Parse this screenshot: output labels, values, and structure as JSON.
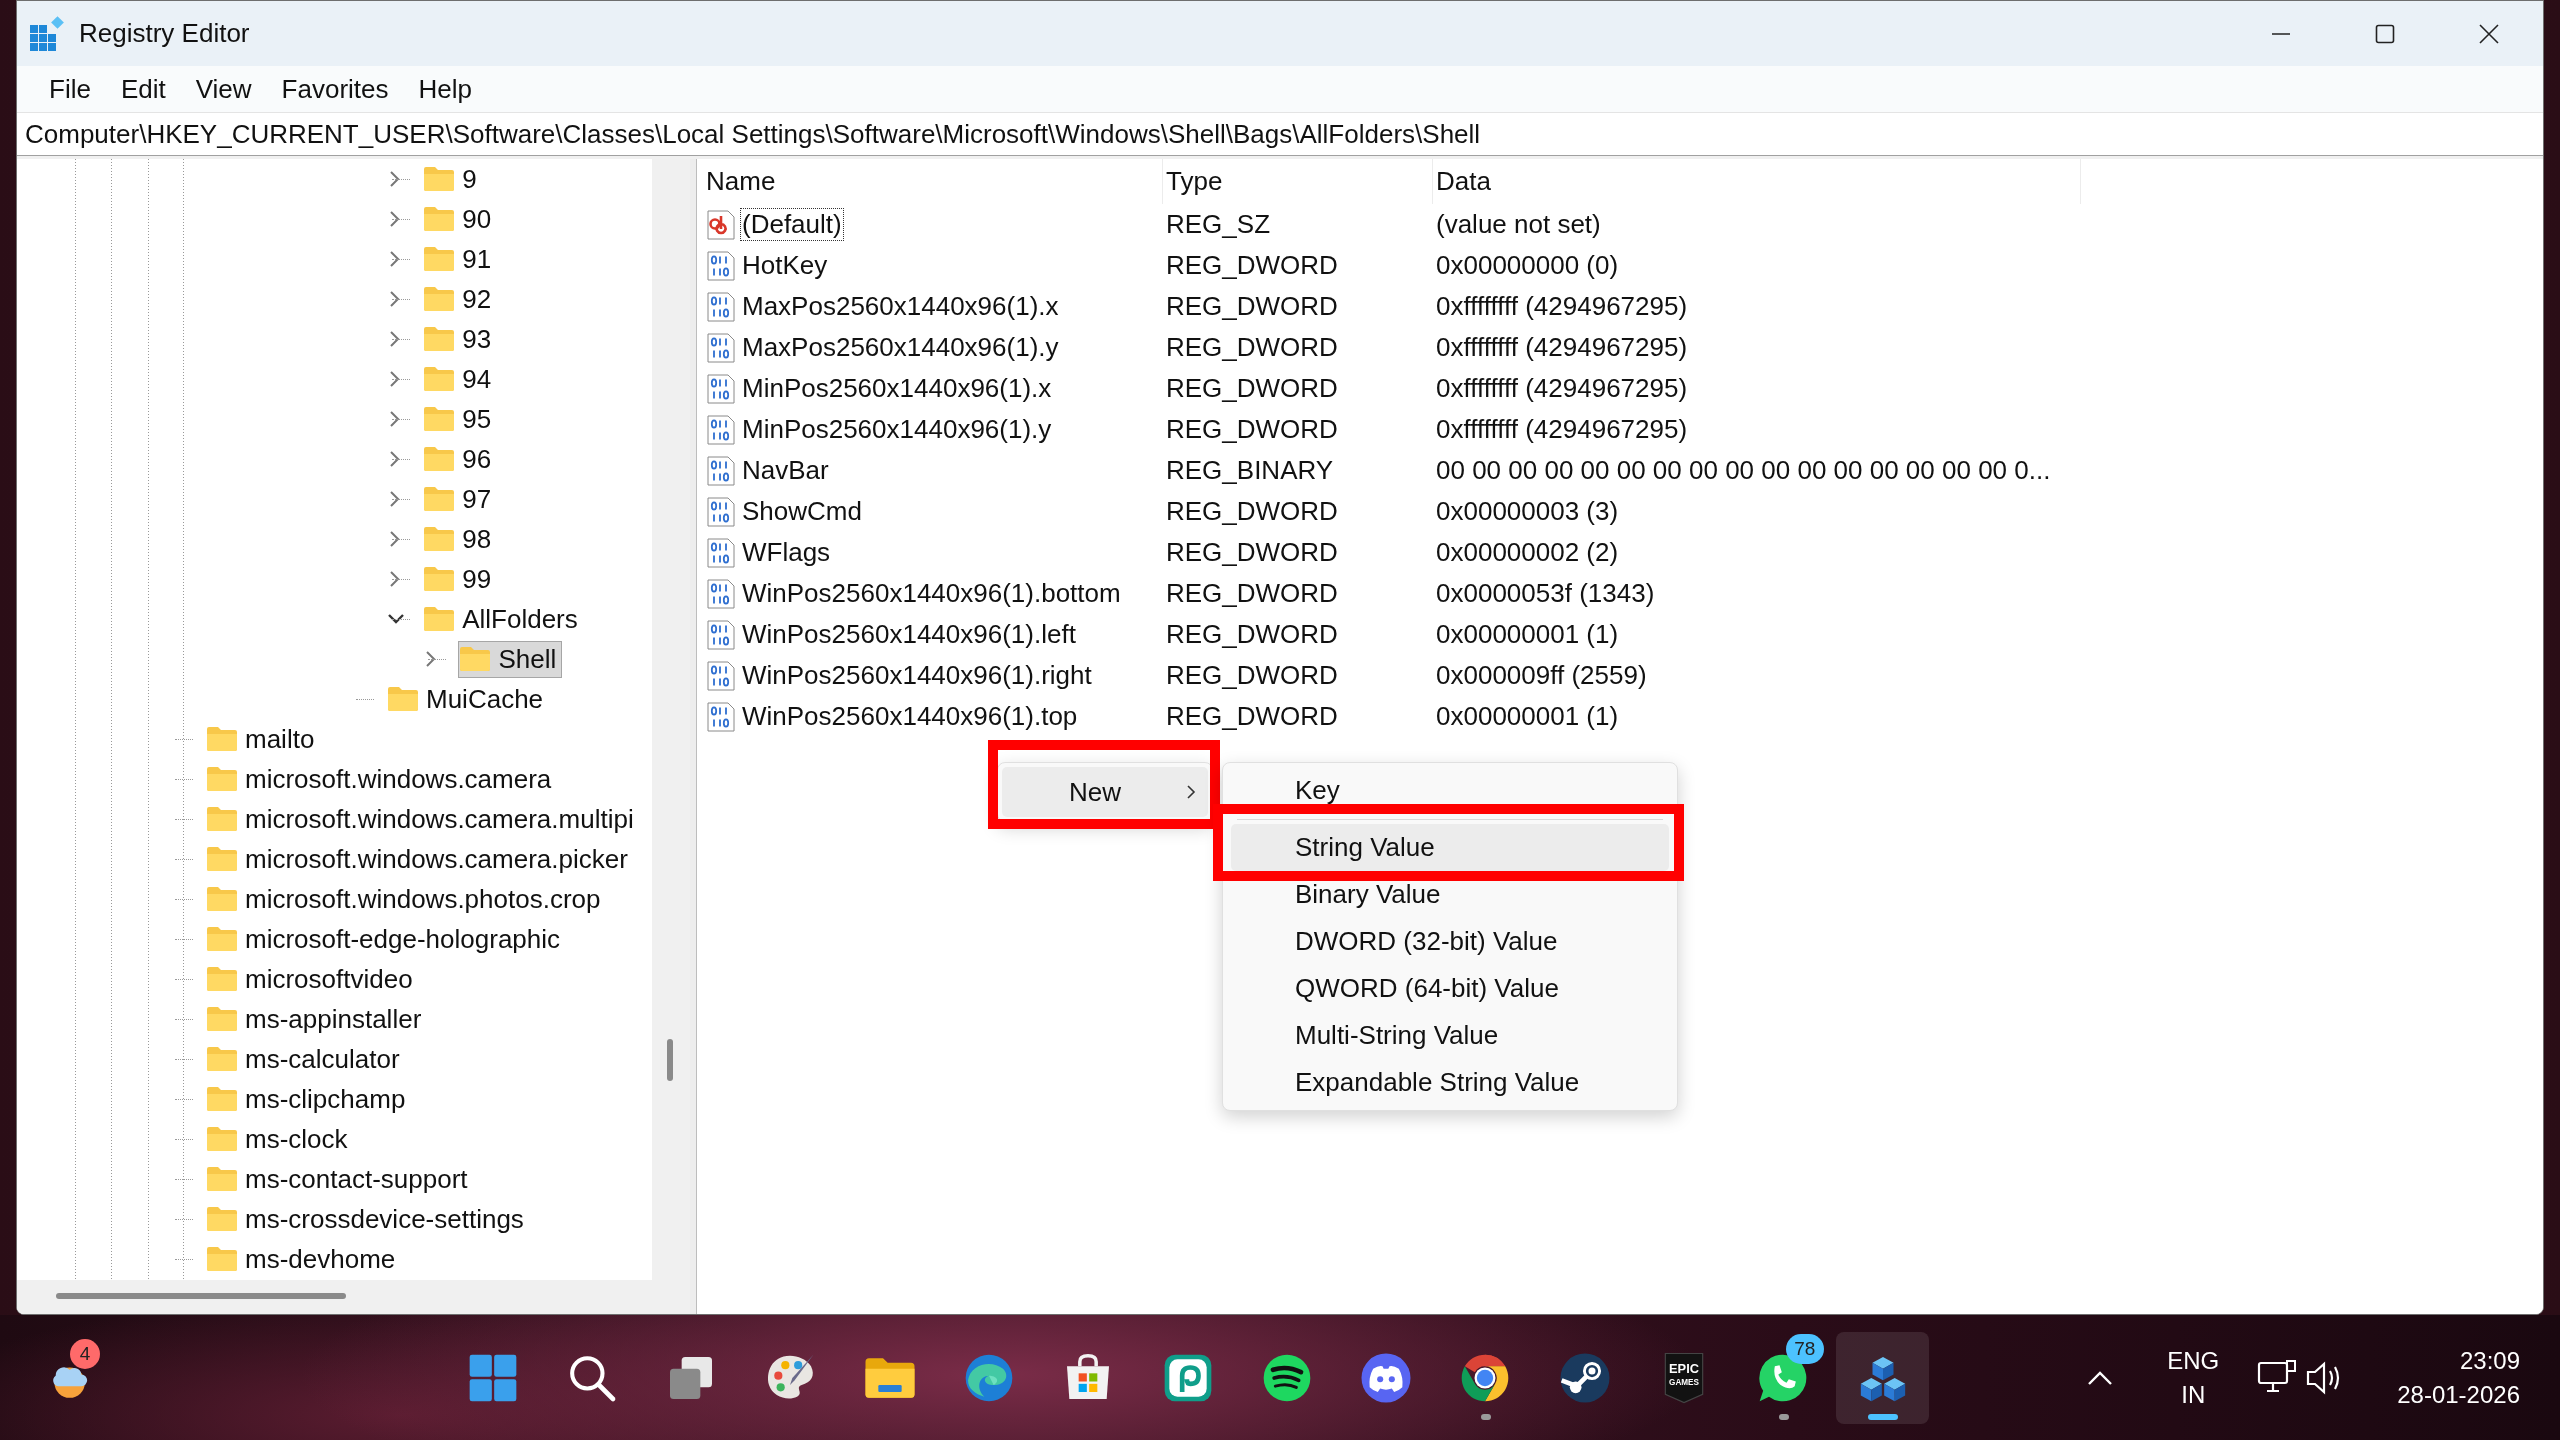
{
  "window": {
    "title": "Registry Editor"
  },
  "menu_bar": [
    "File",
    "Edit",
    "View",
    "Favorites",
    "Help"
  ],
  "address": "Computer\\HKEY_CURRENT_USER\\Software\\Classes\\Local Settings\\Software\\Microsoft\\Windows\\Shell\\Bags\\AllFolders\\Shell",
  "tree": {
    "items": [
      {
        "children": [
          {
            "children": [
              {
                "children": [
                  {
                    "children": [
                      {
                        "children": [
                          {
                            "children": [
                              {
                                "label": "9",
                                "expanded": false,
                                "selected": false
                              },
                              {
                                "label": "90",
                                "expanded": false,
                                "selected": false
                              },
                              {
                                "label": "91",
                                "expanded": false,
                                "selected": false
                              },
                              {
                                "label": "92",
                                "expanded": false,
                                "selected": false
                              },
                              {
                                "label": "93",
                                "expanded": false,
                                "selected": false
                              },
                              {
                                "label": "94",
                                "expanded": false,
                                "selected": false
                              },
                              {
                                "label": "95",
                                "expanded": false,
                                "selected": false
                              },
                              {
                                "label": "96",
                                "expanded": false,
                                "selected": false
                              },
                              {
                                "label": "97",
                                "expanded": false,
                                "selected": false
                              },
                              {
                                "label": "98",
                                "expanded": false,
                                "selected": false
                              },
                              {
                                "label": "99",
                                "expanded": false,
                                "selected": false
                              },
                              {
                                "label": "AllFolders",
                                "expanded": true,
                                "selected": false,
                                "children": [
                                  {
                                    "label": "Shell",
                                    "expanded": false,
                                    "selected": true
                                  }
                                ]
                              }
                            ]
                          },
                          {
                            "label": "MuiCache",
                            "selected": false
                          }
                        ]
                      }
                    ]
                  }
                ]
              }
            ]
          }
        ]
      },
      {
        "label": "mailto",
        "selected": false
      },
      {
        "label": "microsoft.windows.camera",
        "selected": false
      },
      {
        "label": "microsoft.windows.camera.multipi",
        "selected": false
      },
      {
        "label": "microsoft.windows.camera.picker",
        "selected": false
      },
      {
        "label": "microsoft.windows.photos.crop",
        "selected": false
      },
      {
        "label": "microsoft-edge-holographic",
        "selected": false
      },
      {
        "label": "microsoftvideo",
        "selected": false
      },
      {
        "label": "ms-appinstaller",
        "selected": false
      },
      {
        "label": "ms-calculator",
        "selected": false
      },
      {
        "label": "ms-clipchamp",
        "selected": false
      },
      {
        "label": "ms-clock",
        "selected": false
      },
      {
        "label": "ms-contact-support",
        "selected": false
      },
      {
        "label": "ms-crossdevice-settings",
        "selected": false
      },
      {
        "label": "ms-devhome",
        "selected": false
      }
    ]
  },
  "values": {
    "columns": [
      "Name",
      "Type",
      "Data"
    ],
    "rows": [
      {
        "kind": "string",
        "name": "(Default)",
        "type": "REG_SZ",
        "data": "(value not set)",
        "focused": true
      },
      {
        "kind": "binary",
        "name": "HotKey",
        "type": "REG_DWORD",
        "data": "0x00000000 (0)",
        "focused": false
      },
      {
        "kind": "binary",
        "name": "MaxPos2560x1440x96(1).x",
        "type": "REG_DWORD",
        "data": "0xffffffff (4294967295)",
        "focused": false
      },
      {
        "kind": "binary",
        "name": "MaxPos2560x1440x96(1).y",
        "type": "REG_DWORD",
        "data": "0xffffffff (4294967295)",
        "focused": false
      },
      {
        "kind": "binary",
        "name": "MinPos2560x1440x96(1).x",
        "type": "REG_DWORD",
        "data": "0xffffffff (4294967295)",
        "focused": false
      },
      {
        "kind": "binary",
        "name": "MinPos2560x1440x96(1).y",
        "type": "REG_DWORD",
        "data": "0xffffffff (4294967295)",
        "focused": false
      },
      {
        "kind": "binary",
        "name": "NavBar",
        "type": "REG_BINARY",
        "data": "00 00 00 00 00 00 00 00 00 00 00 00 00 00 00 00 0...",
        "focused": false
      },
      {
        "kind": "binary",
        "name": "ShowCmd",
        "type": "REG_DWORD",
        "data": "0x00000003 (3)",
        "focused": false
      },
      {
        "kind": "binary",
        "name": "WFlags",
        "type": "REG_DWORD",
        "data": "0x00000002 (2)",
        "focused": false
      },
      {
        "kind": "binary",
        "name": "WinPos2560x1440x96(1).bottom",
        "type": "REG_DWORD",
        "data": "0x0000053f (1343)",
        "focused": false
      },
      {
        "kind": "binary",
        "name": "WinPos2560x1440x96(1).left",
        "type": "REG_DWORD",
        "data": "0x00000001 (1)",
        "focused": false
      },
      {
        "kind": "binary",
        "name": "WinPos2560x1440x96(1).right",
        "type": "REG_DWORD",
        "data": "0x000009ff (2559)",
        "focused": false
      },
      {
        "kind": "binary",
        "name": "WinPos2560x1440x96(1).top",
        "type": "REG_DWORD",
        "data": "0x00000001 (1)",
        "focused": false
      }
    ]
  },
  "context_menu": {
    "items": [
      {
        "kind": "item",
        "label": "New",
        "has_submenu": true,
        "selected": true,
        "annotated": true
      }
    ]
  },
  "submenu": {
    "items": [
      {
        "kind": "item",
        "label": "Key",
        "selected": false,
        "annotated": false
      },
      {
        "kind": "separator"
      },
      {
        "kind": "item",
        "label": "String Value",
        "selected": true,
        "annotated": true
      },
      {
        "kind": "item",
        "label": "Binary Value",
        "selected": false,
        "annotated": false
      },
      {
        "kind": "item",
        "label": "DWORD (32-bit) Value",
        "selected": false,
        "annotated": false
      },
      {
        "kind": "item",
        "label": "QWORD (64-bit) Value",
        "selected": false,
        "annotated": false
      },
      {
        "kind": "item",
        "label": "Multi-String Value",
        "selected": false,
        "annotated": false
      },
      {
        "kind": "item",
        "label": "Expandable String Value",
        "selected": false,
        "annotated": false
      }
    ]
  },
  "taskbar": {
    "widget": {
      "kind": "weather",
      "badge": "4"
    },
    "apps": [
      {
        "kind": "start",
        "running": false,
        "active": false
      },
      {
        "kind": "search",
        "running": false,
        "active": false
      },
      {
        "kind": "taskview",
        "running": false,
        "active": false
      },
      {
        "kind": "palette",
        "running": false,
        "active": false
      },
      {
        "kind": "folder",
        "running": false,
        "active": false
      },
      {
        "kind": "swirl",
        "running": false,
        "active": false
      },
      {
        "kind": "bag",
        "running": false,
        "active": false
      },
      {
        "kind": "spiral",
        "running": false,
        "active": false
      },
      {
        "kind": "waves",
        "running": false,
        "active": false
      },
      {
        "kind": "gamepad",
        "running": false,
        "active": false
      },
      {
        "kind": "chromering",
        "running": true,
        "active": false
      },
      {
        "kind": "piston",
        "running": false,
        "active": false
      },
      {
        "kind": "shield",
        "running": false,
        "active": false,
        "logo_text": [
          "EPIC",
          "GAMES"
        ]
      },
      {
        "kind": "chat",
        "running": true,
        "active": false,
        "badge": "78"
      },
      {
        "kind": "cubes",
        "running": true,
        "active": true
      }
    ],
    "tray": {
      "language": "ENG",
      "region": "IN",
      "time": "23:09",
      "date": "28-01-2026"
    }
  }
}
